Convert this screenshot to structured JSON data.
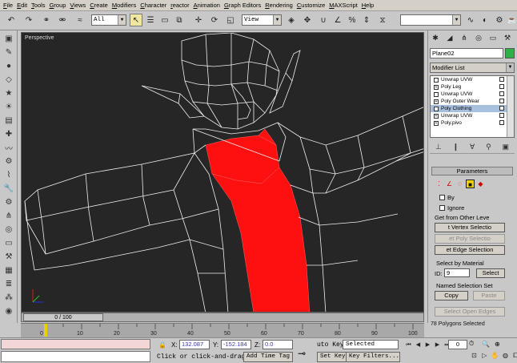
{
  "menu": [
    "File",
    "Edit",
    "Tools",
    "Group",
    "Views",
    "Create",
    "Modifiers",
    "Character",
    "reactor",
    "Animation",
    "Graph Editors",
    "Rendering",
    "Customize",
    "MAXScript",
    "Help"
  ],
  "toolbar": {
    "selection_filter": "All",
    "ref_coord": "View"
  },
  "viewport": {
    "label": "Perspective",
    "background": "#262626",
    "wire_color": "#ffffff",
    "selection_color": "#ff0000"
  },
  "command_panel": {
    "object_name": "Plane02",
    "object_color": "#2db04a",
    "modifier_list": "Modifier List",
    "stack": [
      {
        "label": "Unwrap UVW",
        "selected": false
      },
      {
        "label": "Poly Leg",
        "selected": false
      },
      {
        "label": "Unwrap UVW",
        "selected": false
      },
      {
        "label": "Poly Outer Wear",
        "selected": false
      },
      {
        "label": "Poly Clothing",
        "selected": true
      },
      {
        "label": "Unwrap UVW",
        "selected": false
      },
      {
        "label": "Poly.pivo",
        "selected": false
      }
    ],
    "parameters_title": "Parameters",
    "by_label": "By",
    "ignore_label": "Ignore",
    "get_from_other": "Get from Other Leve",
    "get_vertex": "t Vertex Selectio",
    "get_poly": "et Poly Selectio",
    "get_edge": "et Edge Selection",
    "select_by_material": "Select by Material",
    "id_label": "ID:",
    "id_value": "9",
    "select_btn": "Select",
    "named_sel": "Named Selection Set",
    "copy_btn": "Copy",
    "paste_btn": "Paste",
    "select_open_edges": "Select Open Edges",
    "poly_count": "78 Polygons Selected"
  },
  "timeline": {
    "slider_label": "0 / 100",
    "ticks": [
      "0",
      "10",
      "20",
      "30",
      "40",
      "50",
      "60",
      "70",
      "80",
      "90",
      "100"
    ]
  },
  "status": {
    "x_label": "X:",
    "x_value": "132.087",
    "y_label": "Y:",
    "y_value": "-152.184",
    "z_label": "Z:",
    "z_value": "0.0",
    "prompt": "Click or click-and-drag",
    "add_time_tag": "Add Time Tag",
    "auto_key": "uto Key",
    "selected": "Selected",
    "set_key": "Set Key",
    "key_filters": "Key Filters...",
    "frame": "0"
  }
}
